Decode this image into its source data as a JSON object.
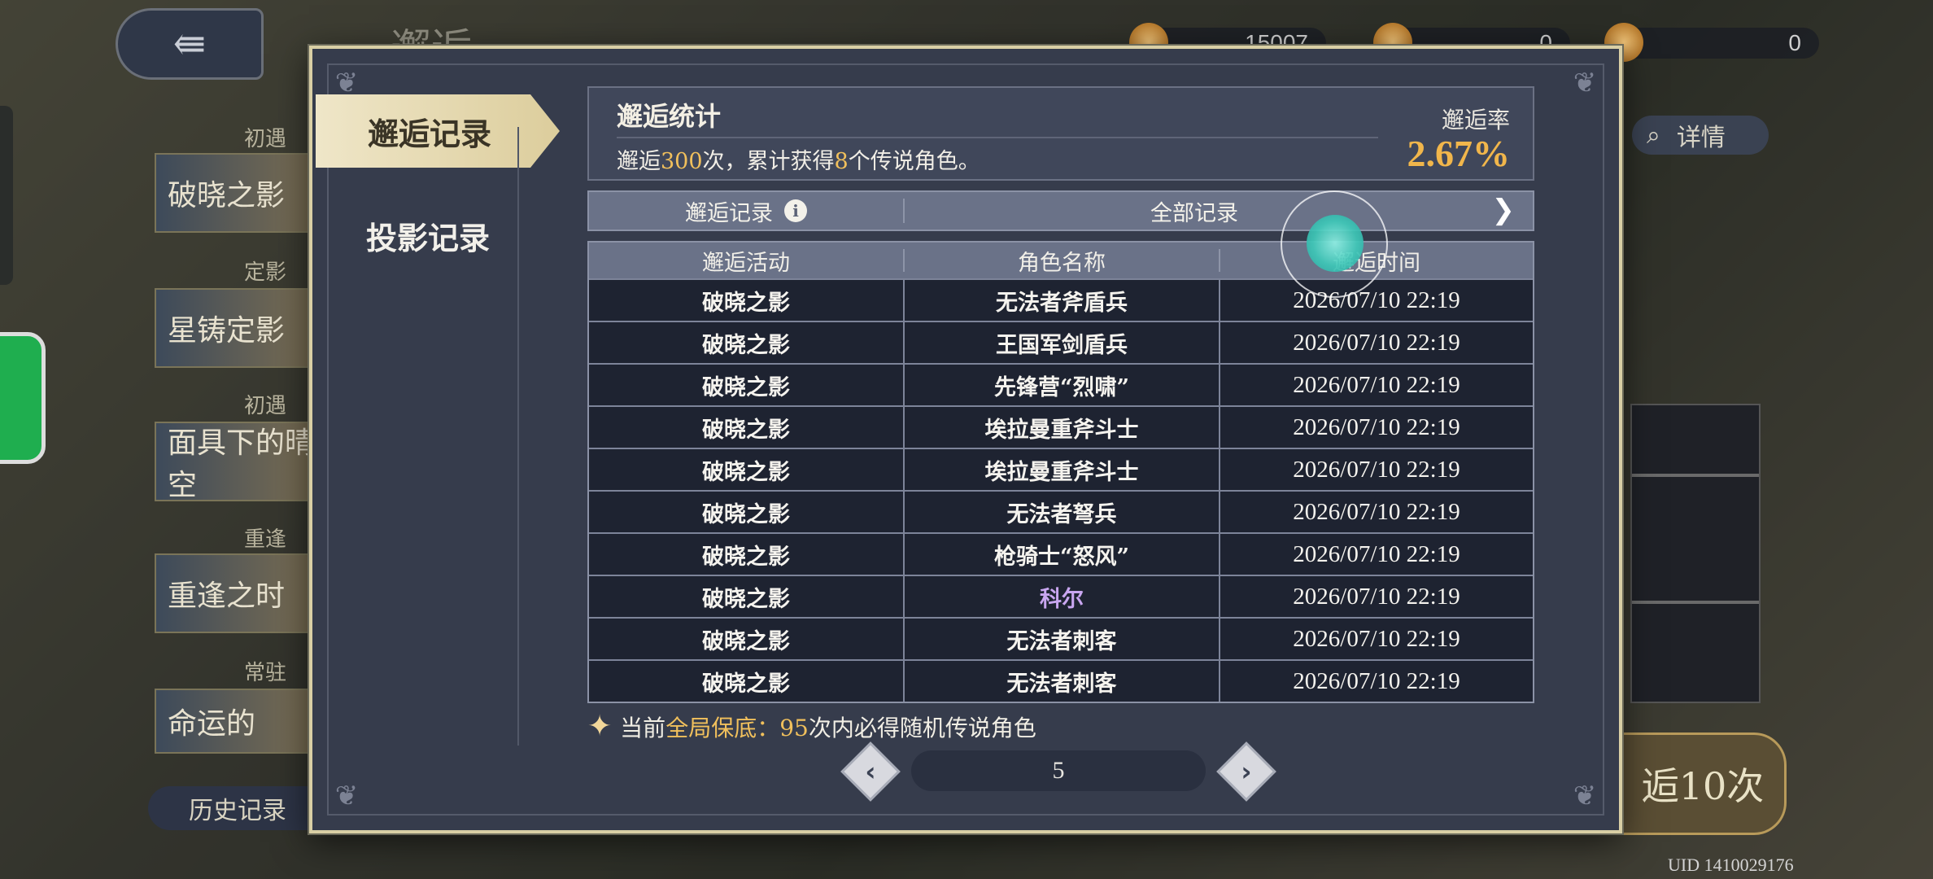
{
  "background": {
    "page_title": "邂逅",
    "currency": [
      {
        "icon": "crystal-icon",
        "value": "15007"
      },
      {
        "icon": "ticket-icon",
        "value": "0"
      },
      {
        "icon": "gem-icon",
        "value": "0"
      }
    ],
    "left_cards": [
      {
        "label": "初遇",
        "title": "破晓之影"
      },
      {
        "label": "定影",
        "title": "星铸定影"
      },
      {
        "label": "初遇",
        "title": "面具下的晴空"
      },
      {
        "label": "重逢",
        "title": "重逢之时"
      },
      {
        "label": "常驻",
        "title": "命运的"
      }
    ],
    "history_label": "历史记录",
    "details_label": "详情",
    "pull_label": "逅10次",
    "uid": "UID 1410029176"
  },
  "modal": {
    "nav": [
      {
        "label": "邂逅记录",
        "active": true
      },
      {
        "label": "投影记录",
        "active": false
      }
    ],
    "stats": {
      "title": "邂逅统计",
      "desc_pre": "邂逅",
      "desc_count": "300",
      "desc_mid": "次，累计获得",
      "desc_legend": "8",
      "desc_post": "个传说角色。",
      "rate_label": "邂逅率",
      "rate_value": "2.67%"
    },
    "record_bar": {
      "left_label": "邂逅记录",
      "filter_label": "全部记录"
    },
    "table": {
      "headers": [
        "邂逅活动",
        "角色名称",
        "邂逅时间"
      ],
      "rows": [
        {
          "event": "破晓之影",
          "name": "无法者斧盾兵",
          "time": "2026/07/10 22:19",
          "color": "#f5f3ee"
        },
        {
          "event": "破晓之影",
          "name": "王国军剑盾兵",
          "time": "2026/07/10 22:19",
          "color": "#f5f3ee"
        },
        {
          "event": "破晓之影",
          "name": "先锋营“烈啸”",
          "time": "2026/07/10 22:19",
          "color": "#f5f3ee"
        },
        {
          "event": "破晓之影",
          "name": "埃拉曼重斧斗士",
          "time": "2026/07/10 22:19",
          "color": "#f5f3ee"
        },
        {
          "event": "破晓之影",
          "name": "埃拉曼重斧斗士",
          "time": "2026/07/10 22:19",
          "color": "#f5f3ee"
        },
        {
          "event": "破晓之影",
          "name": "无法者弩兵",
          "time": "2026/07/10 22:19",
          "color": "#f5f3ee"
        },
        {
          "event": "破晓之影",
          "name": "枪骑士“怒风”",
          "time": "2026/07/10 22:19",
          "color": "#f5f3ee"
        },
        {
          "event": "破晓之影",
          "name": "科尔",
          "time": "2026/07/10 22:19",
          "color": "#c9a6f0"
        },
        {
          "event": "破晓之影",
          "name": "无法者刺客",
          "time": "2026/07/10 22:19",
          "color": "#f5f3ee"
        },
        {
          "event": "破晓之影",
          "name": "无法者刺客",
          "time": "2026/07/10 22:19",
          "color": "#f5f3ee"
        }
      ]
    },
    "pity": {
      "pre": "当前",
      "highlight": "全局保底：",
      "count": "95",
      "post": "次内必得随机传说角色"
    },
    "pager": {
      "page": "5"
    }
  },
  "colors": {
    "accent_gold": "#f1b64b",
    "highlight_yellow": "#f1c05c",
    "rare_purple": "#c9a6f0",
    "frame_gold": "#d9cfa5"
  }
}
